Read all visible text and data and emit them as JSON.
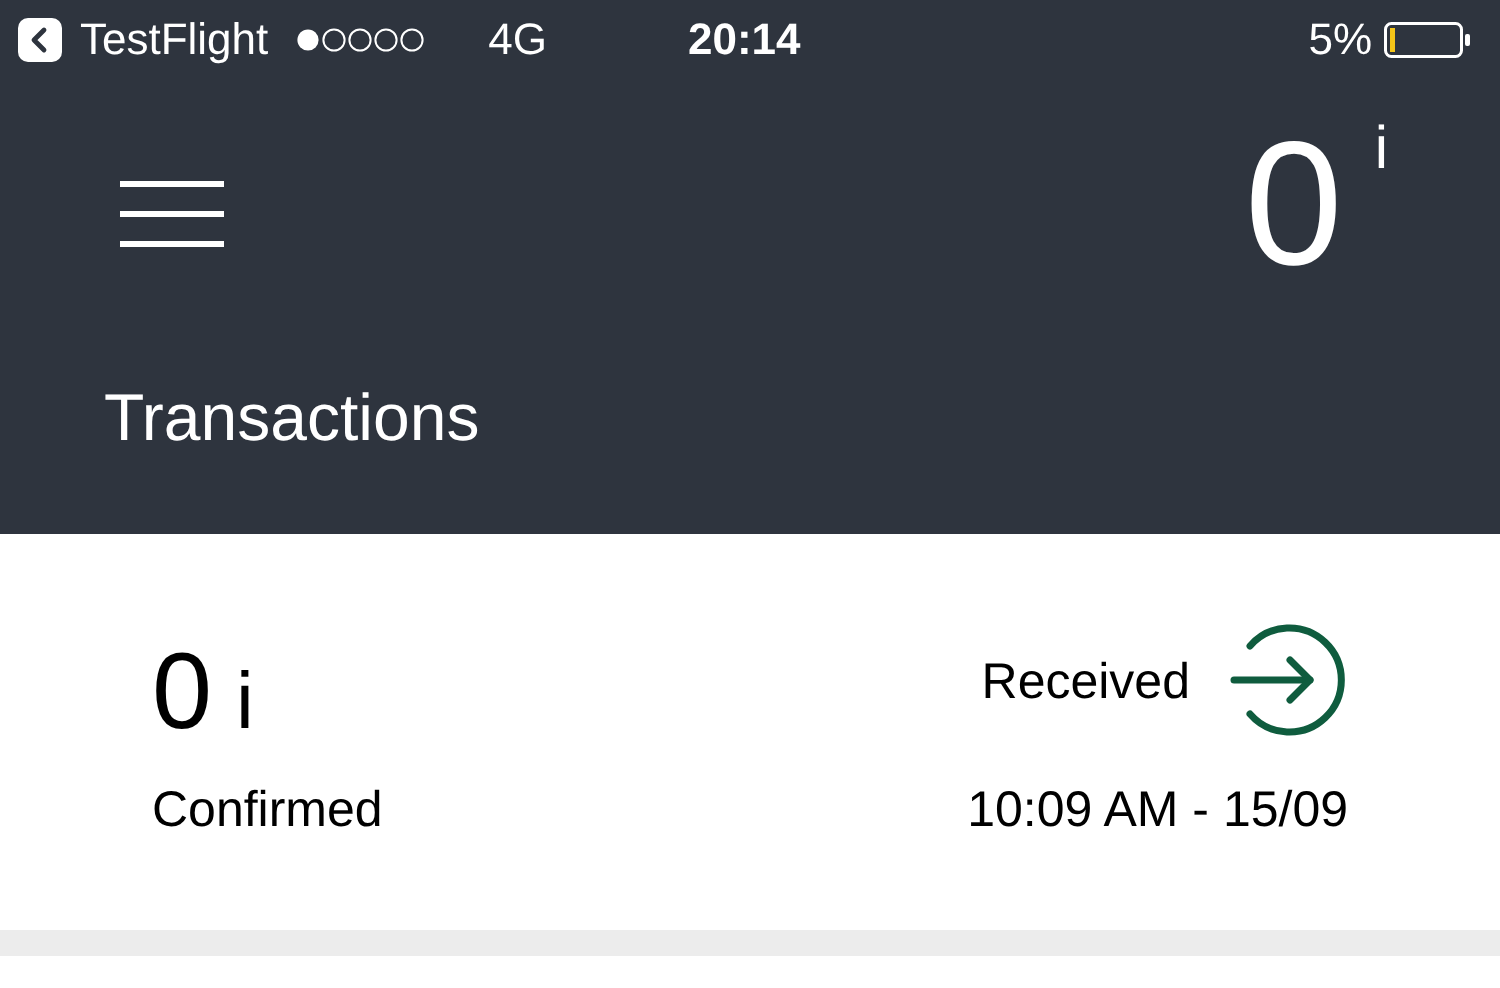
{
  "status_bar": {
    "back_app": "TestFlight",
    "carrier": "4G",
    "time": "20:14",
    "battery": "5%"
  },
  "header": {
    "balance": "0",
    "unit": "i",
    "title": "Transactions"
  },
  "transactions": [
    {
      "amount": "0",
      "unit": "i",
      "direction": "Received",
      "kind": "received",
      "status": "Confirmed",
      "time": "10:09 AM - 15/09"
    }
  ]
}
